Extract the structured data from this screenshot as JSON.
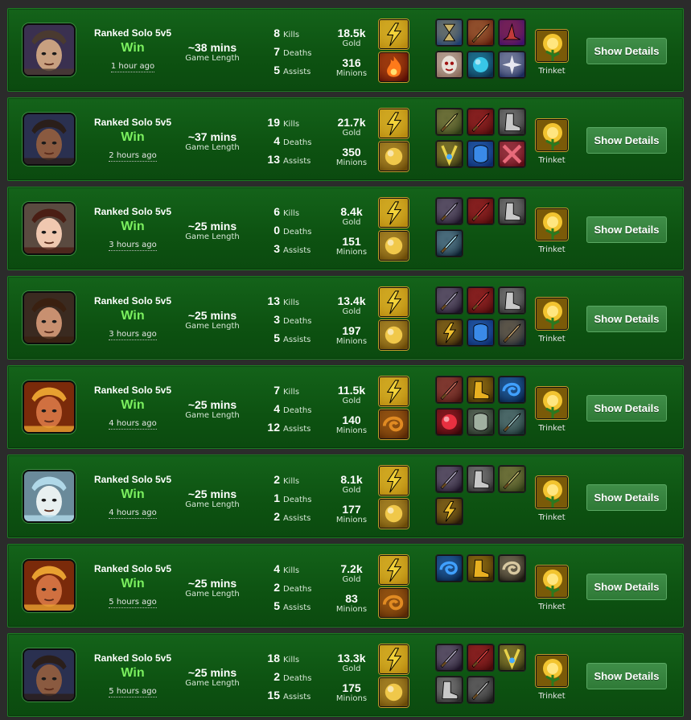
{
  "labels": {
    "kills": "Kills",
    "deaths": "Deaths",
    "assists": "Assists",
    "gold": "Gold",
    "minions": "Minions",
    "game_length": "Game Length",
    "trinket": "Trinket",
    "show_details": "Show Details"
  },
  "colors": {
    "row_bg": "#0d5211",
    "win_text": "#7bf05f",
    "button": "#2f7a37",
    "page_bg": "#2b2b2b"
  },
  "matches": [
    {
      "champion_icon": "gunslinger-portrait-icon",
      "queue": "Ranked Solo 5v5",
      "result": "Win",
      "time_ago": "1 hour ago",
      "length": "~38 mins",
      "kills": "8",
      "deaths": "7",
      "assists": "5",
      "gold": "18.5k",
      "minions": "316",
      "spells": [
        "flash-icon",
        "ignite-icon"
      ],
      "items": [
        "hourglass-icon",
        "crossbow-icon",
        "wizard-hat-icon",
        "mask-icon",
        "blue-orb-blade-icon",
        "compass-icon"
      ]
    },
    {
      "champion_icon": "rifleman-portrait-icon",
      "queue": "Ranked Solo 5v5",
      "result": "Win",
      "time_ago": "2 hours ago",
      "length": "~37 mins",
      "kills": "19",
      "deaths": "4",
      "assists": "13",
      "gold": "21.7k",
      "minions": "350",
      "spells": [
        "flash-icon",
        "heal-icon"
      ],
      "items": [
        "spear-icon",
        "red-blade-icon",
        "armored-boots-icon",
        "yellow-amulet-icon",
        "blue-gauntlet-icon",
        "crossed-blades-icon"
      ]
    },
    {
      "champion_icon": "sheriff-portrait-icon",
      "queue": "Ranked Solo 5v5",
      "result": "Win",
      "time_ago": "3 hours ago",
      "length": "~25 mins",
      "kills": "6",
      "deaths": "0",
      "assists": "3",
      "gold": "8.4k",
      "minions": "151",
      "spells": [
        "flash-icon",
        "heal-icon"
      ],
      "items": [
        "long-sword-icon",
        "red-blade-icon",
        "armored-boots-icon",
        "ice-dagger-icon"
      ]
    },
    {
      "champion_icon": "axeman-portrait-icon",
      "queue": "Ranked Solo 5v5",
      "result": "Win",
      "time_ago": "3 hours ago",
      "length": "~25 mins",
      "kills": "13",
      "deaths": "3",
      "assists": "5",
      "gold": "13.4k",
      "minions": "197",
      "spells": [
        "flash-icon",
        "heal-icon"
      ],
      "items": [
        "long-sword-icon",
        "red-blade-icon",
        "armored-boots-icon",
        "lightning-blade-icon",
        "blue-gauntlet-icon",
        "bow-icon"
      ]
    },
    {
      "champion_icon": "bandit-portrait-icon",
      "queue": "Ranked Solo 5v5",
      "result": "Win",
      "time_ago": "4 hours ago",
      "length": "~25 mins",
      "kills": "7",
      "deaths": "4",
      "assists": "12",
      "gold": "11.5k",
      "minions": "140",
      "spells": [
        "flash-icon",
        "exhaust-icon"
      ],
      "items": [
        "scythe-icon",
        "golden-boots-icon",
        "blue-swirl-icon",
        "red-gem-icon",
        "chest-armor-icon",
        "hammer-icon"
      ]
    },
    {
      "champion_icon": "mage-portrait-icon",
      "queue": "Ranked Solo 5v5",
      "result": "Win",
      "time_ago": "4 hours ago",
      "length": "~25 mins",
      "kills": "2",
      "deaths": "1",
      "assists": "2",
      "gold": "8.1k",
      "minions": "177",
      "spells": [
        "flash-icon",
        "heal-icon"
      ],
      "items": [
        "long-sword-icon",
        "armored-boots-icon",
        "spear-icon",
        "lightning-blade-icon"
      ]
    },
    {
      "champion_icon": "bandit-portrait-icon",
      "queue": "Ranked Solo 5v5",
      "result": "Win",
      "time_ago": "5 hours ago",
      "length": "~25 mins",
      "kills": "4",
      "deaths": "2",
      "assists": "5",
      "gold": "7.2k",
      "minions": "83",
      "spells": [
        "flash-icon",
        "exhaust-icon"
      ],
      "items": [
        "blue-swirl-icon",
        "golden-boots-icon",
        "horn-icon"
      ]
    },
    {
      "champion_icon": "rifleman-portrait-icon",
      "queue": "Ranked Solo 5v5",
      "result": "Win",
      "time_ago": "5 hours ago",
      "length": "~25 mins",
      "kills": "18",
      "deaths": "2",
      "assists": "15",
      "gold": "13.3k",
      "minions": "175",
      "spells": [
        "flash-icon",
        "heal-icon"
      ],
      "items": [
        "long-sword-icon",
        "red-blade-icon",
        "yellow-amulet-icon",
        "armored-boots-icon",
        "greatsword-icon"
      ]
    }
  ]
}
